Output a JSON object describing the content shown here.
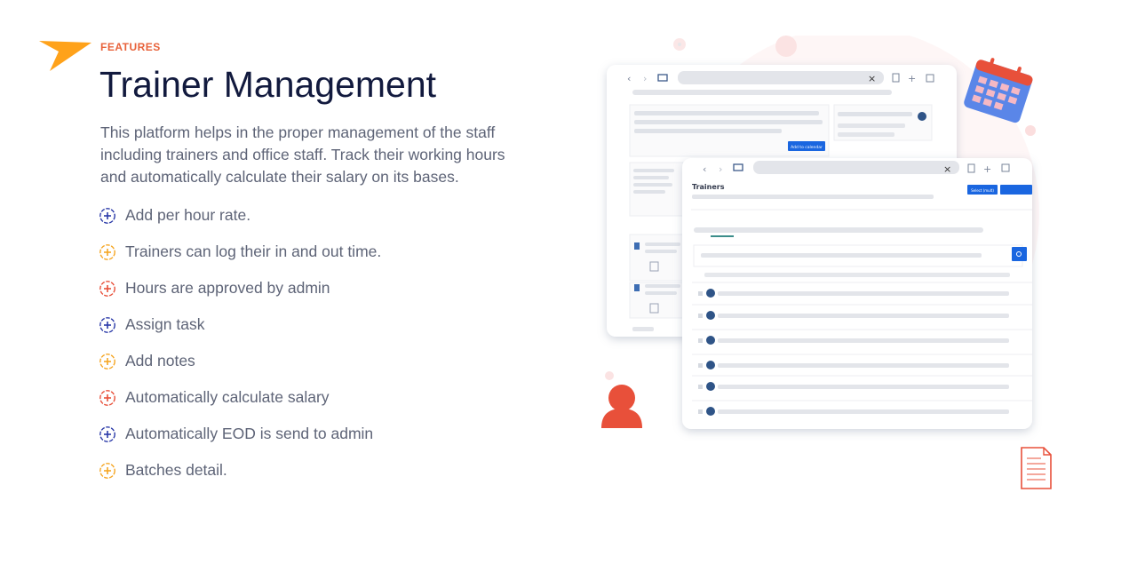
{
  "section": {
    "eyebrow": "FEATURES",
    "title": "Trainer Management",
    "description": "This platform helps in the proper management of the staff including trainers and office staff. Track their working hours and automatically calculate their salary on its bases."
  },
  "features": [
    {
      "label": "Add per hour rate.",
      "color": "#2b3aa8"
    },
    {
      "label": "Trainers can log their in and out time.",
      "color": "#f5a623"
    },
    {
      "label": "Hours are approved by admin",
      "color": "#e8503a"
    },
    {
      "label": "Assign task",
      "color": "#2b3aa8"
    },
    {
      "label": "Add notes",
      "color": "#f5a623"
    },
    {
      "label": "Automatically calculate salary",
      "color": "#e8503a"
    },
    {
      "label": "Automatically EOD is send to admin",
      "color": "#2b3aa8"
    },
    {
      "label": "Batches detail.",
      "color": "#f5a623"
    }
  ],
  "illustration": {
    "back_window": {
      "button_label": "Add to calendar"
    },
    "front_window": {
      "heading": "Trainers",
      "button_label": "Select (mult)"
    }
  },
  "colors": {
    "accent_orange": "#ffa21a",
    "eyebrow": "#e8623a",
    "title": "#121a3e",
    "primary_blue": "#1a66e0"
  },
  "icons": {
    "flag": "flag-icon",
    "feature_bullet": "plus-circle-icon",
    "calendar": "calendar-icon",
    "person": "person-icon",
    "document": "document-icon"
  }
}
